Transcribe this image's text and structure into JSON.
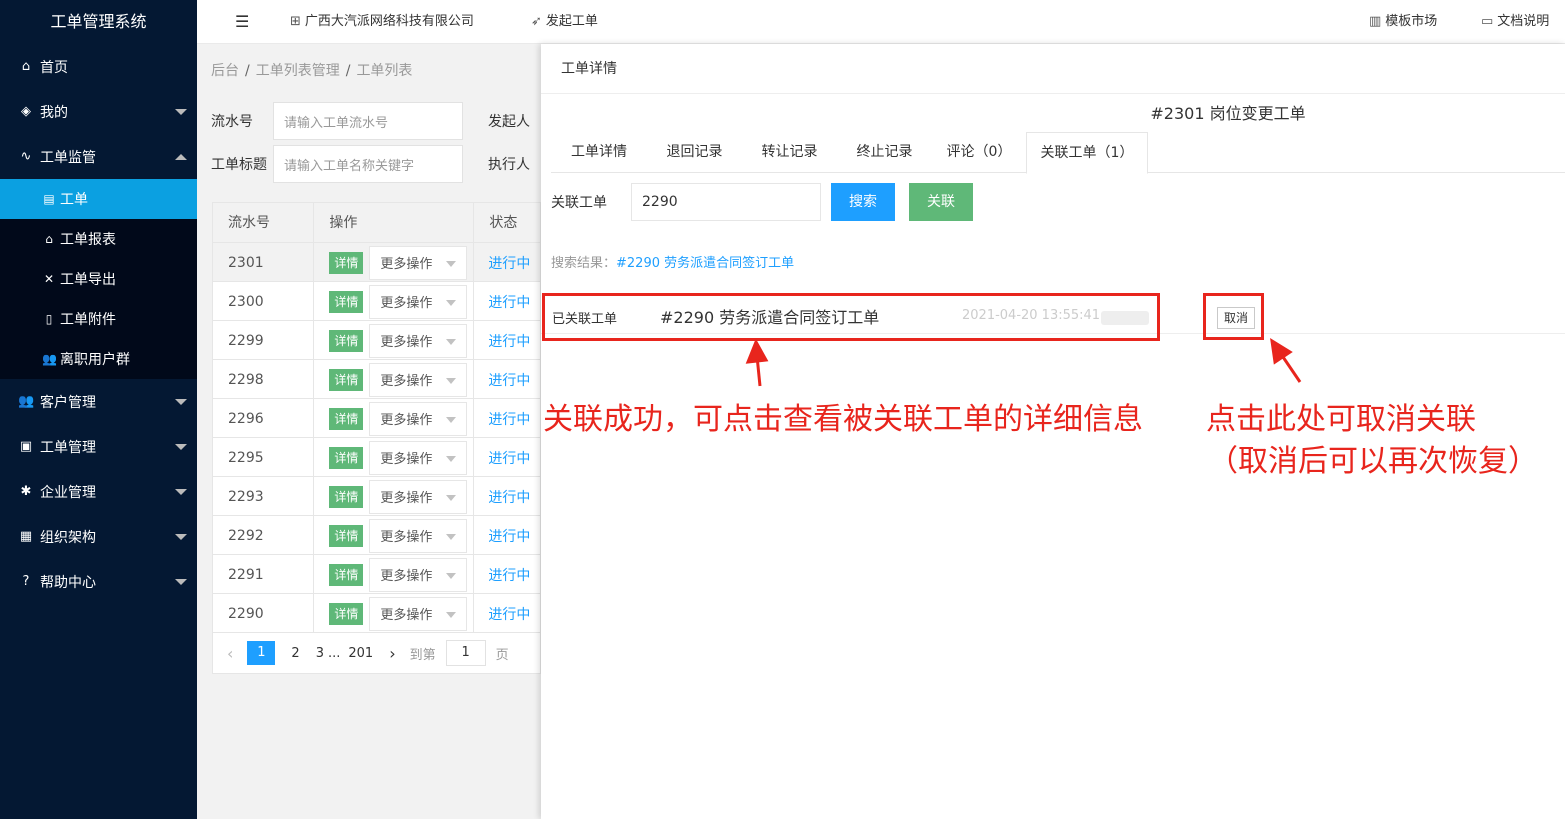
{
  "app": {
    "title": "工单管理系统"
  },
  "sidebar": {
    "items": [
      {
        "label": "首页",
        "icon": "home-icon"
      },
      {
        "label": "我的",
        "icon": "layers-icon"
      },
      {
        "label": "工单监管",
        "icon": "pulse-icon"
      },
      {
        "label": "客户管理",
        "icon": "users-icon"
      },
      {
        "label": "工单管理",
        "icon": "clipboard-icon"
      },
      {
        "label": "企业管理",
        "icon": "gear-icon"
      },
      {
        "label": "组织架构",
        "icon": "calendar-icon"
      },
      {
        "label": "帮助中心",
        "icon": "question-icon"
      }
    ],
    "sub_items": [
      {
        "label": "工单",
        "icon": "document-icon"
      },
      {
        "label": "工单报表",
        "icon": "home-outline-icon"
      },
      {
        "label": "工单导出",
        "icon": "tools-icon"
      },
      {
        "label": "工单附件",
        "icon": "file-icon"
      },
      {
        "label": "离职用户群",
        "icon": "group-icon"
      }
    ]
  },
  "topbar": {
    "company": "广西大汽派网络科技有限公司",
    "start_ticket": "发起工单",
    "template_market": "模板市场",
    "docs": "文档说明"
  },
  "list": {
    "breadcrumb": [
      "后台",
      "工单列表管理",
      "工单列表"
    ],
    "filters": {
      "serial_label": "流水号",
      "serial_placeholder": "请输入工单流水号",
      "initiator_label": "发起人",
      "title_label": "工单标题",
      "title_placeholder": "请输入工单名称关键字",
      "executor_label": "执行人"
    },
    "columns": [
      "流水号",
      "操作",
      "状态"
    ],
    "detail_label": "详情",
    "more_label": "更多操作",
    "status_label": "进行中",
    "rows": [
      "2301",
      "2300",
      "2299",
      "2298",
      "2296",
      "2295",
      "2293",
      "2292",
      "2291",
      "2290"
    ],
    "pager": {
      "pages": [
        "1",
        "2",
        "3"
      ],
      "ellipsis": "...",
      "last": "201",
      "goto": "到第",
      "goto_value": "1",
      "page_unit": "页"
    }
  },
  "panel": {
    "header": "工单详情",
    "title": "#2301 岗位变更工单",
    "tabs": [
      "工单详情",
      "退回记录",
      "转让记录",
      "终止记录",
      "评论（0）",
      "关联工单（1）"
    ],
    "link_label": "关联工单",
    "link_value": "2290",
    "search_btn": "搜索",
    "link_btn": "关联",
    "result_prefix": "搜索结果：",
    "result_link": "#2290 劳务派遣合同签订工单",
    "linked_label": "已关联工单",
    "linked_title": "#2290 劳务派遣合同签订工单",
    "linked_time": "2021-04-20 13:55:41",
    "cancel_btn": "取消"
  },
  "annotations": {
    "left": "关联成功，可点击查看被关联工单的详细信息",
    "right_line1": "点击此处可取消关联",
    "right_line2": "（取消后可以再次恢复）",
    "color": "#e8251d"
  }
}
